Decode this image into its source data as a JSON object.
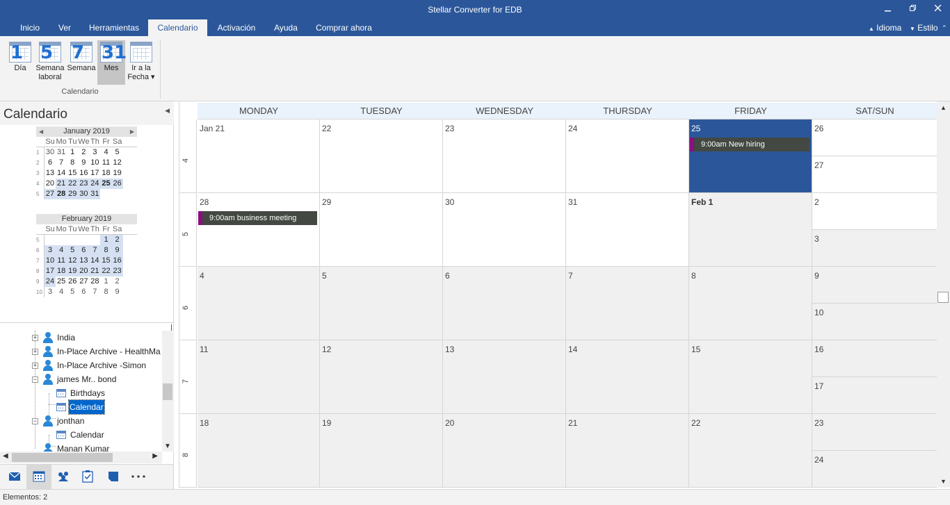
{
  "window": {
    "title": "Stellar Converter for EDB"
  },
  "tabs": [
    {
      "label": "Inicio"
    },
    {
      "label": "Ver"
    },
    {
      "label": "Herramientas"
    },
    {
      "label": "Calendario"
    },
    {
      "label": "Activación"
    },
    {
      "label": "Ayuda"
    },
    {
      "label": "Comprar ahora"
    }
  ],
  "active_tab": "Calendario",
  "tab_right": {
    "idioma": "Idioma",
    "estilo": "Estilo"
  },
  "ribbon": {
    "group_label": "Calendario",
    "buttons": [
      {
        "icon_num": "1",
        "label1": "Día",
        "label2": ""
      },
      {
        "icon_num": "5",
        "label1": "Semana",
        "label2": "laboral"
      },
      {
        "icon_num": "7",
        "label1": "Semana",
        "label2": ""
      },
      {
        "icon_num": "31",
        "label1": "Mes",
        "label2": ""
      },
      {
        "icon_num": "",
        "label1": "Ir a la",
        "label2": "Fecha ▾"
      }
    ]
  },
  "left_pane": {
    "title": "Calendario",
    "mini_calendars": [
      {
        "month": "January 2019",
        "dow": [
          "Su",
          "Mo",
          "Tu",
          "We",
          "Th",
          "Fr",
          "Sa"
        ],
        "weeks": [
          {
            "wn": "1",
            "days": [
              "30",
              "31",
              "1",
              "2",
              "3",
              "4",
              "5"
            ]
          },
          {
            "wn": "2",
            "days": [
              "6",
              "7",
              "8",
              "9",
              "10",
              "11",
              "12"
            ]
          },
          {
            "wn": "3",
            "days": [
              "13",
              "14",
              "15",
              "16",
              "17",
              "18",
              "19"
            ]
          },
          {
            "wn": "4",
            "days": [
              "20",
              "21",
              "22",
              "23",
              "24",
              "25",
              "26"
            ]
          },
          {
            "wn": "5",
            "days": [
              "27",
              "28",
              "29",
              "30",
              "31",
              "",
              ""
            ]
          }
        ]
      },
      {
        "month": "February 2019",
        "dow": [
          "Su",
          "Mo",
          "Tu",
          "We",
          "Th",
          "Fr",
          "Sa"
        ],
        "weeks": [
          {
            "wn": "5",
            "days": [
              "",
              "",
              "",
              "",
              "",
              "1",
              "2"
            ]
          },
          {
            "wn": "6",
            "days": [
              "3",
              "4",
              "5",
              "6",
              "7",
              "8",
              "9"
            ]
          },
          {
            "wn": "7",
            "days": [
              "10",
              "11",
              "12",
              "13",
              "14",
              "15",
              "16"
            ]
          },
          {
            "wn": "8",
            "days": [
              "17",
              "18",
              "19",
              "20",
              "21",
              "22",
              "23"
            ]
          },
          {
            "wn": "9",
            "days": [
              "24",
              "25",
              "26",
              "27",
              "28",
              "1",
              "2"
            ]
          },
          {
            "wn": "10",
            "days": [
              "3",
              "4",
              "5",
              "6",
              "7",
              "8",
              "9"
            ]
          }
        ]
      }
    ],
    "tree": [
      {
        "label": "India"
      },
      {
        "label": "In-Place Archive - HealthMa"
      },
      {
        "label": "In-Place Archive -Simon"
      },
      {
        "label": "james Mr.. bond"
      },
      {
        "label": "Birthdays"
      },
      {
        "label": "Calendar"
      },
      {
        "label": "jonthan"
      },
      {
        "label": "Calendar"
      },
      {
        "label": "Manan Kumar"
      }
    ]
  },
  "status": {
    "text": "Elementos: 2"
  },
  "calendar": {
    "day_headers": [
      "MONDAY",
      "TUESDAY",
      "WEDNESDAY",
      "THURSDAY",
      "FRIDAY",
      "SAT/SUN"
    ],
    "weeks": [
      {
        "wn": "4",
        "days": [
          "Jan 21",
          "22",
          "23",
          "24",
          "25"
        ],
        "sat": "26",
        "sun": "27"
      },
      {
        "wn": "5",
        "days": [
          "28",
          "29",
          "30",
          "31",
          "Feb 1"
        ],
        "sat": "2",
        "sun": "3"
      },
      {
        "wn": "6",
        "days": [
          "4",
          "5",
          "6",
          "7",
          "8"
        ],
        "sat": "9",
        "sun": "10"
      },
      {
        "wn": "7",
        "days": [
          "11",
          "12",
          "13",
          "14",
          "15"
        ],
        "sat": "16",
        "sun": "17"
      },
      {
        "wn": "8",
        "days": [
          "18",
          "19",
          "20",
          "21",
          "22"
        ],
        "sat": "23",
        "sun": "24"
      }
    ],
    "appointments": [
      {
        "text": "9:00am  New hiring"
      },
      {
        "text": "9:00am  business meeting"
      }
    ]
  },
  "colors": {
    "accent": "#2b579a",
    "appointment_bg": "#434842",
    "appointment_bar": "#8a0f82"
  }
}
